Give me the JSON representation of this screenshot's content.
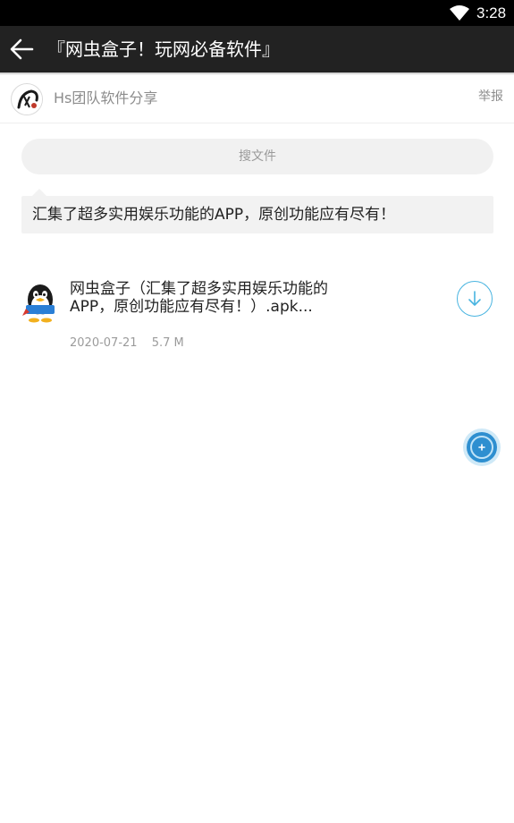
{
  "status_bar": {
    "time": "3:28",
    "wifi_icon": "wifi-icon"
  },
  "app_bar": {
    "title": "『网虫盒子！玩网必备软件』",
    "back_icon": "arrow-left-icon"
  },
  "owner": {
    "name": "Hs团队软件分享",
    "report_label": "举报"
  },
  "search": {
    "placeholder": "搜文件"
  },
  "description": "汇集了超多实用娱乐功能的APP，原创功能应有尽有！",
  "files": [
    {
      "name": "网虫盒子（汇集了超多实用娱乐功能的APP，原创功能应有尽有！）.apk...",
      "date": "2020-07-21",
      "size": "5.7 M",
      "icon": "qq-penguin-icon",
      "action_icon": "download-icon"
    }
  ],
  "fab_icon": "floating-plus-icon",
  "colors": {
    "app_bar": "#222222",
    "accent": "#48b4e0",
    "status_bar": "#000000"
  }
}
